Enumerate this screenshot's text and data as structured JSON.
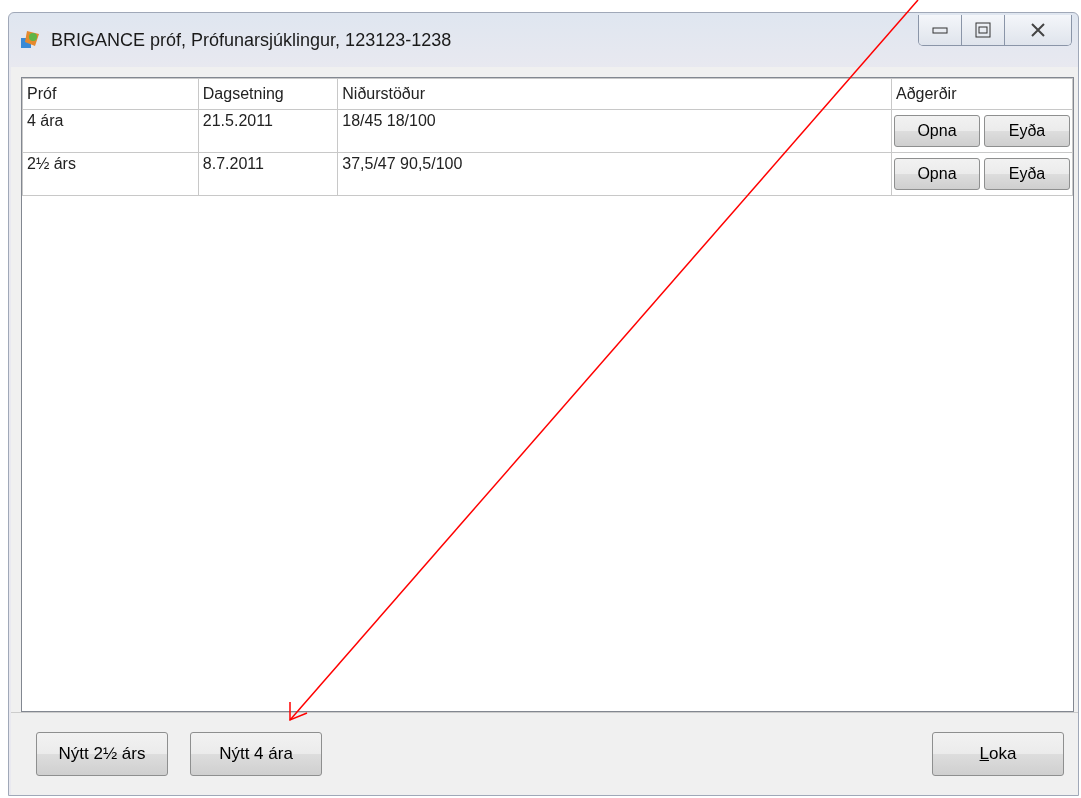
{
  "window": {
    "title": "BRIGANCE próf, Prófunarsjúklingur, 123123-1238"
  },
  "table": {
    "columns": [
      "Próf",
      "Dagsetning",
      "Niðurstöður",
      "Aðgerðir"
    ],
    "rows": [
      {
        "cells": [
          "4 ára",
          "21.5.2011",
          "18/45 18/100"
        ],
        "actions": [
          "Opna",
          "Eyða"
        ]
      },
      {
        "cells": [
          "2½ árs",
          "8.7.2011",
          "37,5/47 90,5/100"
        ],
        "actions": [
          "Opna",
          "Eyða"
        ]
      }
    ]
  },
  "buttons": [
    {
      "label": "Nýtt 2½ árs",
      "kind": "left"
    },
    {
      "label": "Nýtt 4 ára",
      "kind": "left"
    },
    {
      "label": "Loka",
      "kind": "right"
    }
  ]
}
